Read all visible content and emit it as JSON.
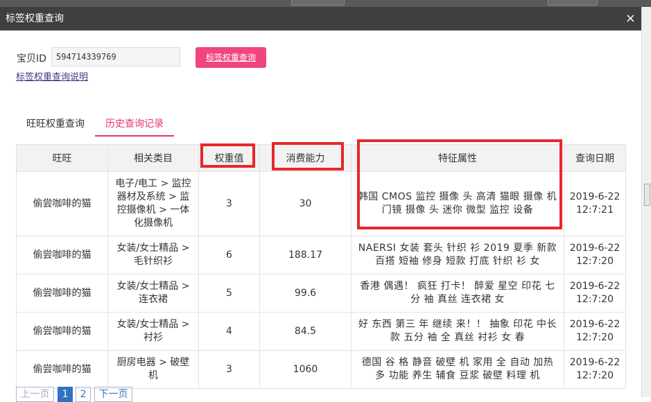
{
  "dialog": {
    "title": "标签权重查询",
    "close_label": "×"
  },
  "form": {
    "id_label": "宝贝ID",
    "id_value": "594714339769",
    "query_button": "标签权重查询",
    "help_link": "标签权重查询说明"
  },
  "tabs": [
    {
      "label": "旺旺权重查询",
      "active": false
    },
    {
      "label": "历史查询记录",
      "active": true
    }
  ],
  "table": {
    "headers": [
      "旺旺",
      "相关类目",
      "权重值",
      "消费能力",
      "特征属性",
      "查询日期"
    ],
    "rows": [
      {
        "wangwang": "偷尝咖啡的猫",
        "category": "电子/电工 > 监控器材及系统 > 监控摄像机 > 一体化摄像机",
        "weight": "3",
        "consumption": "30",
        "features": "韩国 CMOS 监控 摄像 头 高清 猫眼 摄像 机 门镜 摄像 头 迷你 微型 监控 设备",
        "date": "2019-6-22 12:7:21"
      },
      {
        "wangwang": "偷尝咖啡的猫",
        "category": "女装/女士精品 > 毛针织衫",
        "weight": "6",
        "consumption": "188.17",
        "features": "NAERSI 女装 套头 针织 衫 2019 夏季 新款 百搭 短袖 修身 短款 打底 针织 衫 女",
        "date": "2019-6-22 12:7:20"
      },
      {
        "wangwang": "偷尝咖啡的猫",
        "category": "女装/女士精品 > 连衣裙",
        "weight": "5",
        "consumption": "99.6",
        "features": "香港 偶遇！ 疯狂 打卡！ 醉爱 星空 印花 七分 袖 真丝 连衣裙 女",
        "date": "2019-6-22 12:7:20"
      },
      {
        "wangwang": "偷尝咖啡的猫",
        "category": "女装/女士精品 > 衬衫",
        "weight": "4",
        "consumption": "84.5",
        "features": "好 东西 第三 年 继续 来！！ 抽象 印花 中长 款 五分 袖 全 真丝 衬衫 女 春",
        "date": "2019-6-22 12:7:20"
      },
      {
        "wangwang": "偷尝咖啡的猫",
        "category": "厨房电器 > 破壁机",
        "weight": "3",
        "consumption": "1060",
        "features": "德国 谷 格 静音 破壁 机 家用 全 自动 加热 多 功能 养生 辅食 豆浆 破壁 料理 机",
        "date": "2019-6-22 12:7:20"
      }
    ]
  },
  "pager": {
    "prev": "上一页",
    "pages": [
      "1",
      "2"
    ],
    "current": "1",
    "next": "下一页"
  },
  "colors": {
    "accent": "#e8336d",
    "button": "#f0467f",
    "highlight_box": "#e8262b",
    "titlebar": "#3f3f3f"
  }
}
